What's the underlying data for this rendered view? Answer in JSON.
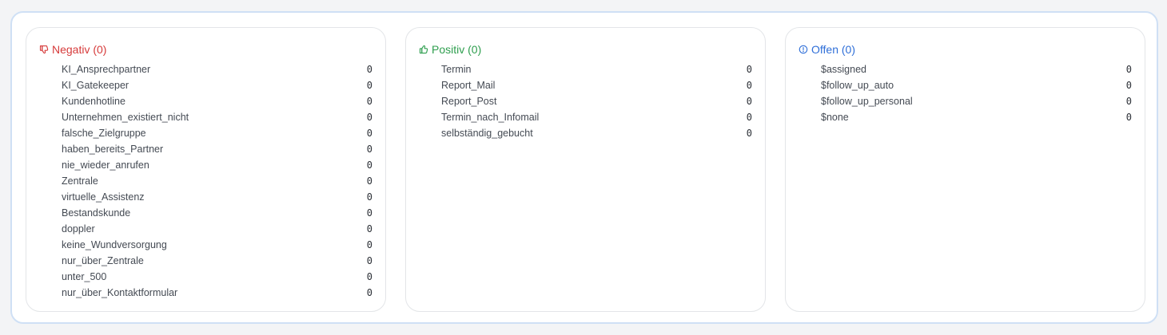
{
  "panels": {
    "negativ": {
      "title": "Negativ (0)",
      "icon": "thumbs-down-icon",
      "color": "#d63a3a",
      "items": [
        {
          "label": "KI_Ansprechpartner",
          "count": "0"
        },
        {
          "label": "KI_Gatekeeper",
          "count": "0"
        },
        {
          "label": "Kundenhotline",
          "count": "0"
        },
        {
          "label": "Unternehmen_existiert_nicht",
          "count": "0"
        },
        {
          "label": "falsche_Zielgruppe",
          "count": "0"
        },
        {
          "label": "haben_bereits_Partner",
          "count": "0"
        },
        {
          "label": "nie_wieder_anrufen",
          "count": "0"
        },
        {
          "label": "Zentrale",
          "count": "0"
        },
        {
          "label": "virtuelle_Assistenz",
          "count": "0"
        },
        {
          "label": "Bestandskunde",
          "count": "0"
        },
        {
          "label": "doppler",
          "count": "0"
        },
        {
          "label": "keine_Wundversorgung",
          "count": "0"
        },
        {
          "label": "nur_über_Zentrale",
          "count": "0"
        },
        {
          "label": "unter_500",
          "count": "0"
        },
        {
          "label": "nur_über_Kontaktformular",
          "count": "0"
        }
      ]
    },
    "positiv": {
      "title": "Positiv (0)",
      "icon": "thumbs-up-icon",
      "color": "#2e9e4e",
      "items": [
        {
          "label": "Termin",
          "count": "0"
        },
        {
          "label": "Report_Mail",
          "count": "0"
        },
        {
          "label": "Report_Post",
          "count": "0"
        },
        {
          "label": "Termin_nach_Infomail",
          "count": "0"
        },
        {
          "label": "selbständig_gebucht",
          "count": "0"
        }
      ]
    },
    "offen": {
      "title": "Offen (0)",
      "icon": "alert-circle-icon",
      "color": "#2f6fd8",
      "items": [
        {
          "label": "$assigned",
          "count": "0"
        },
        {
          "label": "$follow_up_auto",
          "count": "0"
        },
        {
          "label": "$follow_up_personal",
          "count": "0"
        },
        {
          "label": "$none",
          "count": "0"
        }
      ]
    }
  }
}
